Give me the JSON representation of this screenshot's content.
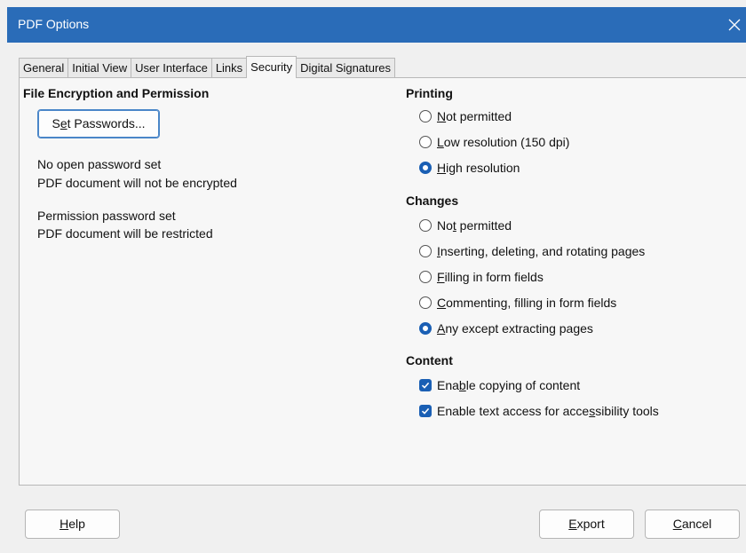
{
  "window": {
    "title": "PDF Options",
    "close_glyph": "close-icon"
  },
  "tabs": [
    {
      "label": "General",
      "active": false
    },
    {
      "label": "Initial View",
      "active": false
    },
    {
      "label": "User Interface",
      "active": false
    },
    {
      "label": "Links",
      "active": false
    },
    {
      "label": "Security",
      "active": true
    },
    {
      "label": "Digital Signatures",
      "active": false
    }
  ],
  "encryption": {
    "heading": "File Encryption and Permission",
    "set_passwords": {
      "pre": "S",
      "ul": "e",
      "post": "t Passwords..."
    },
    "open_status": [
      "No open password set",
      "PDF document will not be encrypted"
    ],
    "permission_status": [
      "Permission password set",
      "PDF document will be restricted"
    ]
  },
  "printing": {
    "heading": "Printing",
    "options": [
      {
        "pre": "",
        "ul": "N",
        "post": "ot permitted",
        "checked": false
      },
      {
        "pre": "",
        "ul": "L",
        "post": "ow resolution (150 dpi)",
        "checked": false
      },
      {
        "pre": "",
        "ul": "H",
        "post": "igh resolution",
        "checked": true
      }
    ]
  },
  "changes": {
    "heading": "Changes",
    "options": [
      {
        "pre": "No",
        "ul": "t",
        "post": " permitted",
        "checked": false
      },
      {
        "pre": "",
        "ul": "I",
        "post": "nserting, deleting, and rotating pages",
        "checked": false
      },
      {
        "pre": "",
        "ul": "F",
        "post": "illing in form fields",
        "checked": false
      },
      {
        "pre": "",
        "ul": "C",
        "post": "ommenting, filling in form fields",
        "checked": false
      },
      {
        "pre": "",
        "ul": "A",
        "post": "ny except extracting pages",
        "checked": true
      }
    ]
  },
  "content": {
    "heading": "Content",
    "options": [
      {
        "pre": "Ena",
        "ul": "b",
        "post": "le copying of content",
        "checked": true
      },
      {
        "pre": "Enable text access for acce",
        "ul": "s",
        "post": "sibility tools",
        "checked": true
      }
    ]
  },
  "footer": {
    "help": {
      "pre": "",
      "ul": "H",
      "post": "elp"
    },
    "export": {
      "pre": "",
      "ul": "E",
      "post": "xport"
    },
    "cancel": {
      "pre": "",
      "ul": "C",
      "post": "ancel"
    }
  },
  "colors": {
    "titlebar": "#2a6cb8",
    "accent": "#1a5fb4"
  }
}
